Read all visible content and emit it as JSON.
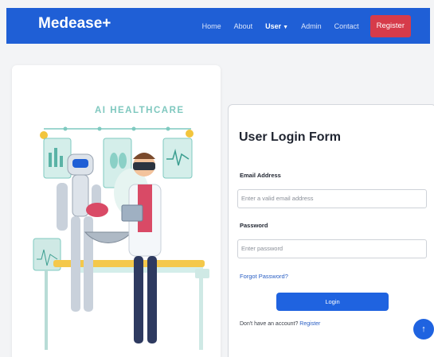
{
  "brand": "Medease+",
  "nav": {
    "home": "Home",
    "about": "About",
    "user": "User",
    "admin": "Admin",
    "contact": "Contact",
    "register": "Register"
  },
  "illustration": {
    "heading": "AI HEALTHCARE"
  },
  "login": {
    "title": "User Login Form",
    "email_label": "Email Address",
    "email_placeholder": "Enter a valid email address",
    "password_label": "Password",
    "password_placeholder": "Enter password",
    "forgot": "Forgot Password?",
    "button": "Login",
    "no_account": "Don't have an account?",
    "register_link": "Register"
  },
  "colors": {
    "navbar": "#1f5fd6",
    "register_button": "#d63b4a",
    "primary_button": "#1f63e0"
  },
  "icons": {
    "dropdown": "caret-down",
    "scroll_top": "arrow-up"
  }
}
